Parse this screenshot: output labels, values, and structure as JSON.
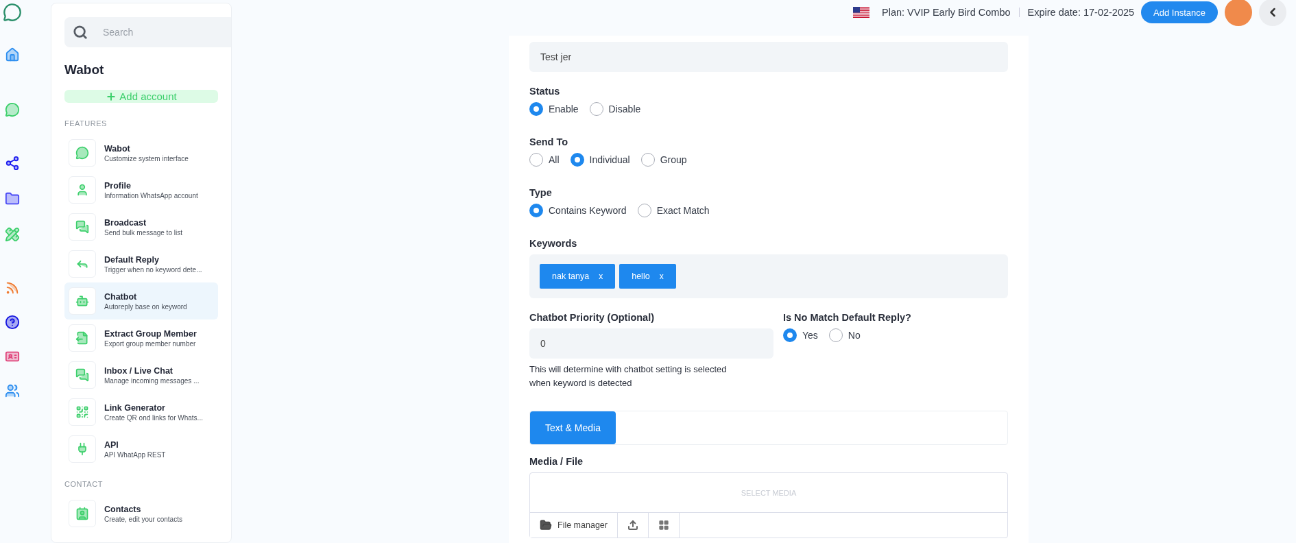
{
  "topbar": {
    "plan": "Plan: VVIP Early Bird Combo",
    "expire": "Expire date: 17-02-2025",
    "add_button": "Add Instance"
  },
  "sidebar": {
    "search_placeholder": "Search",
    "title": "Wabot",
    "add_account": "Add account",
    "sections": [
      {
        "heading": "FEATURES",
        "items": [
          {
            "title": "Wabot",
            "subtitle": "Customize system interface",
            "selected": false
          },
          {
            "title": "Profile",
            "subtitle": "Information WhatsApp account",
            "selected": false
          },
          {
            "title": "Broadcast",
            "subtitle": "Send bulk message to list",
            "selected": false
          },
          {
            "title": "Default Reply",
            "subtitle": "Trigger when no keyword dete...",
            "selected": false
          },
          {
            "title": "Chatbot",
            "subtitle": "Autoreply base on keyword",
            "selected": true
          },
          {
            "title": "Extract Group Member",
            "subtitle": "Export group member number",
            "selected": false
          },
          {
            "title": "Inbox / Live Chat",
            "subtitle": "Manage incoming messages ...",
            "selected": false
          },
          {
            "title": "Link Generator",
            "subtitle": "Create QR ond links for Whats...",
            "selected": false
          },
          {
            "title": "API",
            "subtitle": "API WhatApp REST",
            "selected": false
          }
        ]
      },
      {
        "heading": "CONTACT",
        "items": [
          {
            "title": "Contacts",
            "subtitle": "Create, edit your contacts",
            "selected": false
          }
        ]
      }
    ]
  },
  "form": {
    "name_value": "Test jer",
    "radio_groups": [
      {
        "label": "Status",
        "options": [
          {
            "label": "Enable",
            "selected": true
          },
          {
            "label": "Disable",
            "selected": false
          }
        ]
      },
      {
        "label": "Send To",
        "options": [
          {
            "label": "All",
            "selected": false
          },
          {
            "label": "Individual",
            "selected": true
          },
          {
            "label": "Group",
            "selected": false
          }
        ]
      },
      {
        "label": "Type",
        "options": [
          {
            "label": "Contains Keyword",
            "selected": true
          },
          {
            "label": "Exact Match",
            "selected": false
          }
        ]
      }
    ],
    "keywords": {
      "label": "Keywords",
      "tags": [
        {
          "text": "nak tanya",
          "remove": "x"
        },
        {
          "text": "hello",
          "remove": "x"
        }
      ]
    },
    "priority": {
      "label": "Chatbot Priority (Optional)",
      "value": "0",
      "help": "This will determine with chatbot setting is selected when keyword is detected"
    },
    "default_reply": {
      "label": "Is No Match Default Reply?",
      "options": [
        {
          "label": "Yes",
          "selected": true
        },
        {
          "label": "No",
          "selected": false
        }
      ]
    },
    "tabs": [
      {
        "label": "Text & Media",
        "selected": true
      }
    ],
    "media": {
      "label": "Media / File",
      "placeholder": "SELECT MEDIA",
      "file_manager": "File manager"
    }
  }
}
